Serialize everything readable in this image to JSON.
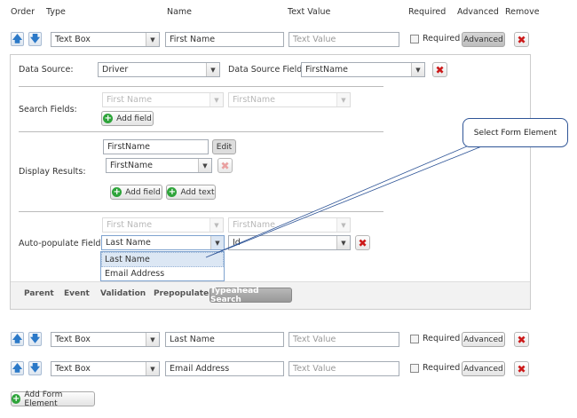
{
  "headers": {
    "order": "Order",
    "type": "Type",
    "name": "Name",
    "text_value": "Text Value",
    "required": "Required",
    "advanced": "Advanced",
    "remove": "Remove"
  },
  "rows": [
    {
      "type": "Text Box",
      "name": "First Name",
      "text_value_placeholder": "Text Value",
      "required_label": "Required",
      "required": false,
      "advanced_label": "Advanced",
      "advanced_active": true
    },
    {
      "type": "Text Box",
      "name": "Last Name",
      "text_value_placeholder": "Text Value",
      "required_label": "Required",
      "required": false,
      "advanced_label": "Advanced",
      "advanced_active": false
    },
    {
      "type": "Text Box",
      "name": "Email Address",
      "text_value_placeholder": "Text Value",
      "required_label": "Required",
      "required": false,
      "advanced_label": "Advanced",
      "advanced_active": false
    }
  ],
  "panel": {
    "data_source_label": "Data Source:",
    "data_source": "Driver",
    "data_source_field_label": "Data Source Field:",
    "data_source_field": "FirstName",
    "search_fields_label": "Search Fields:",
    "search_field_1": "First Name",
    "search_field_2": "FirstName",
    "add_field": "Add field",
    "display_results_label": "Display Results:",
    "display_input": "FirstName",
    "edit": "Edit",
    "display_select": "FirstName",
    "add_text": "Add text",
    "autopop_label": "Auto-populate Fields:",
    "autopop_disabled_1": "First Name",
    "autopop_disabled_2": "FirstName",
    "autopop_select": "Last Name",
    "autopop_field": "Id",
    "dropdown_options": [
      "Last Name",
      "Email Address"
    ],
    "tabs": [
      "Parent",
      "Event",
      "Validation",
      "Prepopulate",
      "Typeahead Search"
    ],
    "active_tab": "Typeahead Search"
  },
  "callout": "Select Form Element",
  "add_form_element": "Add Form Element"
}
